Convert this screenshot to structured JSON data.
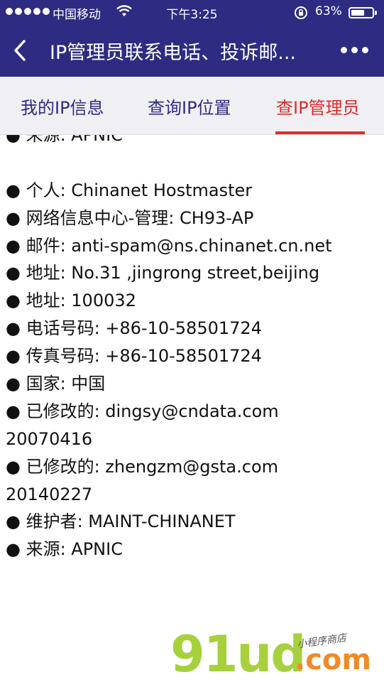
{
  "status_bar": {
    "carrier": "中国移动",
    "time": "下午3:25",
    "battery_percent": "63%",
    "battery_level": 0.63,
    "icons": [
      "signal-dots-icon",
      "wifi-icon",
      "rotation-lock-icon",
      "battery-icon"
    ]
  },
  "nav": {
    "title": "IP管理员联系电话、投诉邮...",
    "back_icon": "chevron-left-icon",
    "more_icon": "more-horizontal-icon"
  },
  "tabs": [
    {
      "label": "我的IP信息",
      "active": false
    },
    {
      "label": "查询IP位置",
      "active": false
    },
    {
      "label": "查IP管理员",
      "active": true
    }
  ],
  "colors": {
    "header_bg": "#2e2b82",
    "tab_text": "#2e2b82",
    "active_tab": "#e02a2a",
    "watermark_green": "#a6d13c",
    "watermark_orange": "#f08a28"
  },
  "content": {
    "lines": [
      "● 来源: APNIC",
      "",
      "● 个人: Chinanet Hostmaster",
      "● 网络信息中心-管理: CH93-AP",
      "● 邮件: anti-spam@ns.chinanet.cn.net",
      "● 地址: No.31 ,jingrong street,beijing",
      "● 地址: 100032",
      "● 电话号码: +86-10-58501724",
      "● 传真号码: +86-10-58501724",
      "● 国家: 中国",
      "● 已修改的: dingsy@cndata.com",
      "20070416",
      "● 已修改的: zhengzm@gsta.com",
      "20140227",
      "● 维护者: MAINT-CHINANET",
      "● 来源: APNIC"
    ]
  },
  "watermark": {
    "main": "91ud",
    "dot_com": ".com",
    "sub": "小程序商店"
  }
}
